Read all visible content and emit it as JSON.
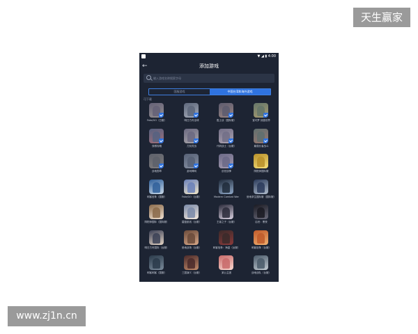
{
  "watermarks": {
    "top_right": "天生赢家",
    "bottom_left": "www.zj1n.cn"
  },
  "status_bar": {
    "time": "4:00",
    "icons": [
      "wifi-icon",
      "signal-icon",
      "battery-icon"
    ]
  },
  "header": {
    "back_icon": "back-arrow-icon",
    "title": "添加游戏"
  },
  "search": {
    "placeholder": "输入游戏名称搜索字母"
  },
  "tabs": [
    {
      "label": "国服游戏",
      "active": false
    },
    {
      "label": "中国台湾和海外游戏",
      "active": true
    }
  ],
  "section_label": "可下载",
  "colors": {
    "background": "#1d2433",
    "accent": "#2f73e0"
  },
  "games": [
    {
      "label": "Fate/GO（日服）",
      "selected": true,
      "c1": "#4b3b56",
      "c2": "#b9a38f"
    },
    {
      "label": "明日方舟全球",
      "selected": true,
      "c1": "#3d4a60",
      "c2": "#dfe3ea"
    },
    {
      "label": "胜士谈（国际服）",
      "selected": true,
      "c1": "#3a2f44",
      "c2": "#c58c6f"
    },
    {
      "label": "宝可梦 剑盾世界",
      "selected": true,
      "c1": "#4c6a3a",
      "c2": "#e8c24a"
    },
    {
      "label": "双眼攻略",
      "selected": true,
      "c1": "#2c3d6b",
      "c2": "#d65a5a"
    },
    {
      "label": "刀剑灵战",
      "selected": true,
      "c1": "#5a4e6c",
      "c2": "#e6d6c8"
    },
    {
      "label": "代码战士（台服）",
      "selected": true,
      "c1": "#6a5a7a",
      "c2": "#f0d0d8"
    },
    {
      "label": "最强长者战斗",
      "selected": true,
      "c1": "#3f5a45",
      "c2": "#c66f4a"
    },
    {
      "label": "战地勋章",
      "selected": true,
      "c1": "#3b3b3b",
      "c2": "#8a7a66"
    },
    {
      "label": "游戏棒网",
      "selected": true,
      "c1": "#2e3c55",
      "c2": "#9aa6b8"
    },
    {
      "label": "创世战神",
      "selected": true,
      "c1": "#5b4e7a",
      "c2": "#e0c0d8"
    },
    {
      "label": "阴阳师国际服",
      "selected": false,
      "c1": "#b8902a",
      "c2": "#f5e07a"
    },
    {
      "label": "刺客信条（国服）",
      "selected": false,
      "c1": "#2f5f9a",
      "c2": "#c8d8e8"
    },
    {
      "label": "Fate/GO（台服）",
      "selected": false,
      "c1": "#6a80b8",
      "c2": "#f1e6c8"
    },
    {
      "label": "Modern Combat War",
      "selected": false,
      "c1": "#1f2a3a",
      "c2": "#8fa8c8"
    },
    {
      "label": "绝地求生国际服（国际服）",
      "selected": false,
      "c1": "#2a3a5a",
      "c2": "#b0bccc"
    },
    {
      "label": "阴阳师国际（国际服）",
      "selected": false,
      "c1": "#8a6a4a",
      "c2": "#f0e0d0"
    },
    {
      "label": "碧蓝航线（台服）",
      "selected": false,
      "c1": "#7a8aa8",
      "c2": "#f3e8dc"
    },
    {
      "label": "王者之子（台服）",
      "selected": false,
      "c1": "#2a2a3a",
      "c2": "#d8d0e0"
    },
    {
      "label": "后世：黑夜",
      "selected": false,
      "c1": "#1a1a22",
      "c2": "#6a6a7a"
    },
    {
      "label": "明日方舟国际（台服）",
      "selected": false,
      "c1": "#3a3f55",
      "c2": "#e2d2c2"
    },
    {
      "label": "绝地战场（台服）",
      "selected": false,
      "c1": "#6a4a3a",
      "c2": "#d8a888"
    },
    {
      "label": "刺客信条：海盗（台服）",
      "selected": false,
      "c1": "#3a2a2a",
      "c2": "#8a3a3a"
    },
    {
      "label": "刺客信条（台服）",
      "selected": false,
      "c1": "#c05a2a",
      "c2": "#f0b070"
    },
    {
      "label": "刺客刺客（国服）",
      "selected": false,
      "c1": "#2a3a4a",
      "c2": "#7a8a9a"
    },
    {
      "label": "三国演义（台服）",
      "selected": false,
      "c1": "#4a2a2a",
      "c2": "#c08a6a"
    },
    {
      "label": "某公主团",
      "selected": false,
      "c1": "#c86a6a",
      "c2": "#f8d8d0"
    },
    {
      "label": "战地战队（台服）",
      "selected": false,
      "c1": "#4a5a6a",
      "c2": "#c0c8d0"
    }
  ]
}
